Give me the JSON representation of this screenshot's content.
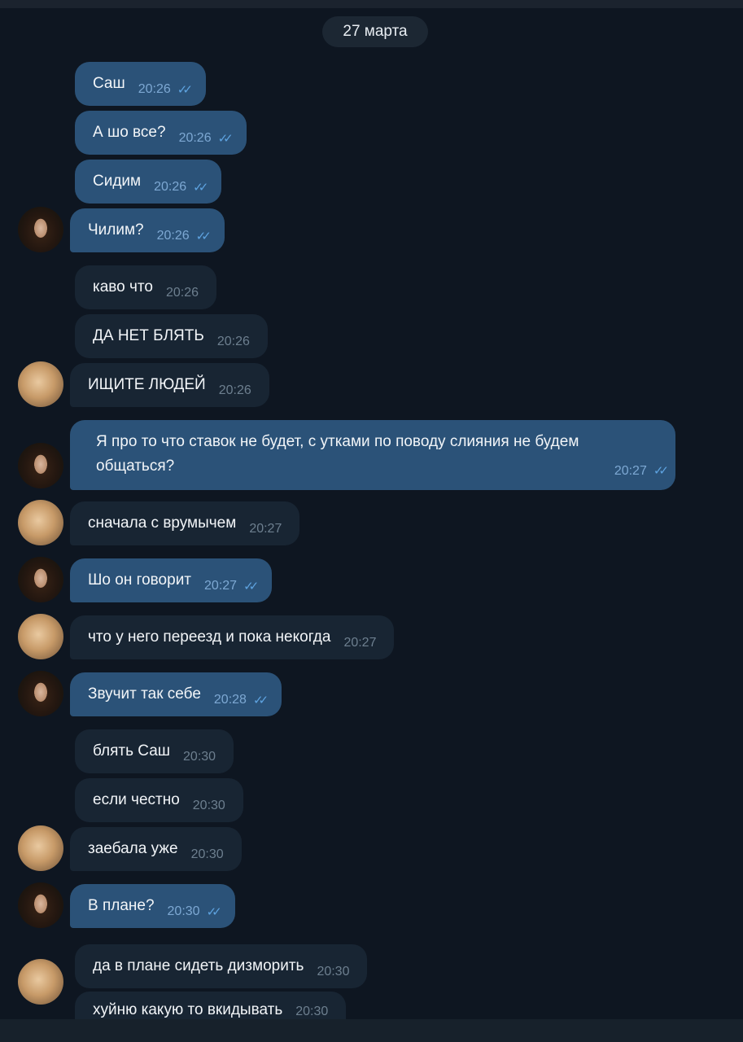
{
  "chat": {
    "date_label": "27 марта",
    "messages": [
      {
        "dir": "out",
        "text": "Саш",
        "time": "20:26",
        "ticks": "✓✓"
      },
      {
        "dir": "out",
        "text": "А шо все?",
        "time": "20:26",
        "ticks": "✓✓"
      },
      {
        "dir": "out",
        "text": "Сидим",
        "time": "20:26",
        "ticks": "✓✓"
      },
      {
        "dir": "out",
        "text": "Чилим?",
        "time": "20:26",
        "ticks": "✓✓"
      },
      {
        "dir": "in",
        "text": "каво что",
        "time": "20:26"
      },
      {
        "dir": "in",
        "text": "ДА НЕТ БЛЯТЬ",
        "time": "20:26"
      },
      {
        "dir": "in",
        "text": "ИЩИТЕ ЛЮДЕЙ",
        "time": "20:26"
      },
      {
        "dir": "out",
        "text": "Я про то что ставок не будет, с утками по поводу слияния не будем общаться?",
        "time": "20:27",
        "ticks": "✓✓"
      },
      {
        "dir": "in",
        "text": "сначала с врумычем",
        "time": "20:27"
      },
      {
        "dir": "out",
        "text": "Шо он говорит",
        "time": "20:27",
        "ticks": "✓✓"
      },
      {
        "dir": "in",
        "text": "что у него переезд и пока некогда",
        "time": "20:27"
      },
      {
        "dir": "out",
        "text": "Звучит так себе",
        "time": "20:28",
        "ticks": "✓✓"
      },
      {
        "dir": "in",
        "text": "блять Саш",
        "time": "20:30"
      },
      {
        "dir": "in",
        "text": "если честно",
        "time": "20:30"
      },
      {
        "dir": "in",
        "text": "заебала уже",
        "time": "20:30"
      },
      {
        "dir": "out",
        "text": "В плане?",
        "time": "20:30",
        "ticks": "✓✓"
      },
      {
        "dir": "in",
        "text": "да в плане сидеть дизморить",
        "time": "20:30"
      },
      {
        "dir": "in",
        "text": "хуйню какую то вкидывать",
        "time": "20:30"
      }
    ]
  },
  "colors": {
    "background": "#0e1621",
    "outgoing_bubble": "#2b5278",
    "incoming_bubble": "#182533",
    "read_ticks": "#5ea3e0"
  },
  "icons": {
    "read_receipt": "double-check-icon",
    "avatar_self": "avatar-girl",
    "avatar_other": "avatar-cat"
  }
}
